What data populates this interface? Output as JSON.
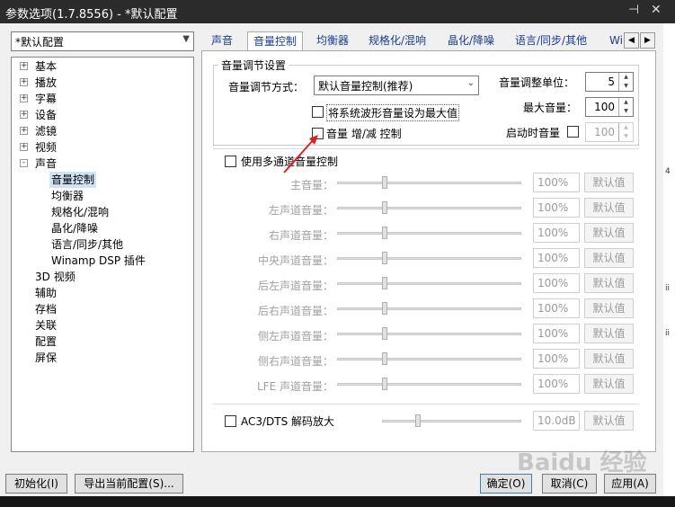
{
  "window": {
    "title": "参数选项(1.7.8556) - *默认配置"
  },
  "profile_combo": {
    "value": "*默认配置"
  },
  "tree": {
    "items": [
      {
        "label": "基本",
        "level": 0,
        "expander": "+"
      },
      {
        "label": "播放",
        "level": 0,
        "expander": "+"
      },
      {
        "label": "字幕",
        "level": 0,
        "expander": "+"
      },
      {
        "label": "设备",
        "level": 0,
        "expander": "+"
      },
      {
        "label": "滤镜",
        "level": 0,
        "expander": "+"
      },
      {
        "label": "视频",
        "level": 0,
        "expander": "+"
      },
      {
        "label": "声音",
        "level": 0,
        "expander": "-"
      },
      {
        "label": "音量控制",
        "level": 1,
        "selected": true
      },
      {
        "label": "均衡器",
        "level": 1
      },
      {
        "label": "规格化/混响",
        "level": 1
      },
      {
        "label": "晶化/降噪",
        "level": 1
      },
      {
        "label": "语言/同步/其他",
        "level": 1
      },
      {
        "label": "Winamp DSP 插件",
        "level": 1
      },
      {
        "label": "3D 视频",
        "level": 0
      },
      {
        "label": "辅助",
        "level": 0
      },
      {
        "label": "存档",
        "level": 0
      },
      {
        "label": "关联",
        "level": 0
      },
      {
        "label": "配置",
        "level": 0
      },
      {
        "label": "屏保",
        "level": 0
      }
    ]
  },
  "tabs": [
    {
      "label": "声音"
    },
    {
      "label": "音量控制",
      "active": true
    },
    {
      "label": "均衡器"
    },
    {
      "label": "规格化/混响"
    },
    {
      "label": "晶化/降噪"
    },
    {
      "label": "语言/同步/其他"
    },
    {
      "label": "Wi"
    }
  ],
  "volume_group": {
    "title": "音量调节设置",
    "mode_label": "音量调节方式：",
    "mode_value": "默认音量控制(推荐)",
    "chk_waveform": "将系统波形音量设为最大值",
    "chk_incdec": "音量 增/减 控制",
    "step_label": "音量调整单位：",
    "step_value": "5",
    "max_label": "最大音量：",
    "max_value": "100",
    "startup_label": "启动时音量",
    "startup_value": "100"
  },
  "multichannel": {
    "label": "使用多通道音量控制",
    "default_label": "默认值",
    "channels": [
      {
        "name": "主音量：",
        "value": "100%",
        "level": 0.25
      },
      {
        "name": "左声道音量：",
        "value": "100%",
        "level": 0.25
      },
      {
        "name": "右声道音量：",
        "value": "100%",
        "level": 0.25
      },
      {
        "name": "中央声道音量：",
        "value": "100%",
        "level": 0.25
      },
      {
        "name": "后左声道音量：",
        "value": "100%",
        "level": 0.25
      },
      {
        "name": "后右声道音量：",
        "value": "100%",
        "level": 0.25
      },
      {
        "name": "侧左声道音量：",
        "value": "100%",
        "level": 0.25
      },
      {
        "name": "侧右声道音量：",
        "value": "100%",
        "level": 0.25
      },
      {
        "name": "LFE 声道音量：",
        "value": "100%",
        "level": 0.25
      }
    ]
  },
  "ac3": {
    "label": "AC3/DTS 解码放大",
    "value": "10.0dB",
    "default_label": "默认值",
    "level": 0.25
  },
  "footer": {
    "init": "初始化(I)",
    "export": "导出当前配置(S)...",
    "ok": "确定(O)",
    "cancel": "取消(C)",
    "apply": "应用(A)"
  },
  "watermark": "Baidu 经验"
}
